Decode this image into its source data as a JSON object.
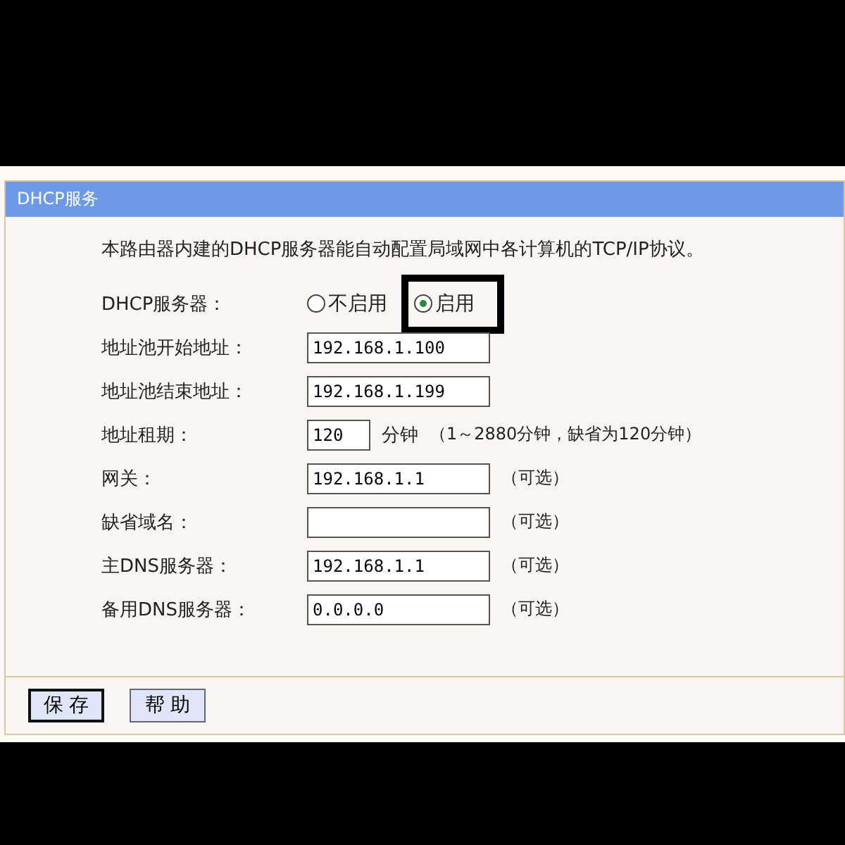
{
  "panel": {
    "title": "DHCP服务",
    "description": "本路由器内建的DHCP服务器能自动配置局域网中各计算机的TCP/IP协议。"
  },
  "server": {
    "label": "DHCP服务器：",
    "options": [
      {
        "label": "不启用",
        "selected": false
      },
      {
        "label": "启用",
        "selected": true
      }
    ]
  },
  "fields": [
    {
      "label": "地址池开始地址：",
      "value": "192.168.1.100"
    },
    {
      "label": "地址池结束地址：",
      "value": "192.168.1.199"
    },
    {
      "label": "地址租期：",
      "value": "120",
      "kind": "short",
      "unit": "分钟",
      "note": "（1～2880分钟，缺省为120分钟）"
    },
    {
      "label": "网关：",
      "value": "192.168.1.1",
      "note": "（可选）"
    },
    {
      "label": "缺省域名：",
      "note": "（可选）"
    },
    {
      "label": "主DNS服务器：",
      "value": "192.168.1.1",
      "note": "（可选）"
    },
    {
      "label": "备用DNS服务器：",
      "value": "0.0.0.0",
      "note": "（可选）"
    }
  ],
  "buttons": [
    {
      "label": "保 存",
      "selected": true
    },
    {
      "label": "帮 助",
      "selected": false
    }
  ]
}
